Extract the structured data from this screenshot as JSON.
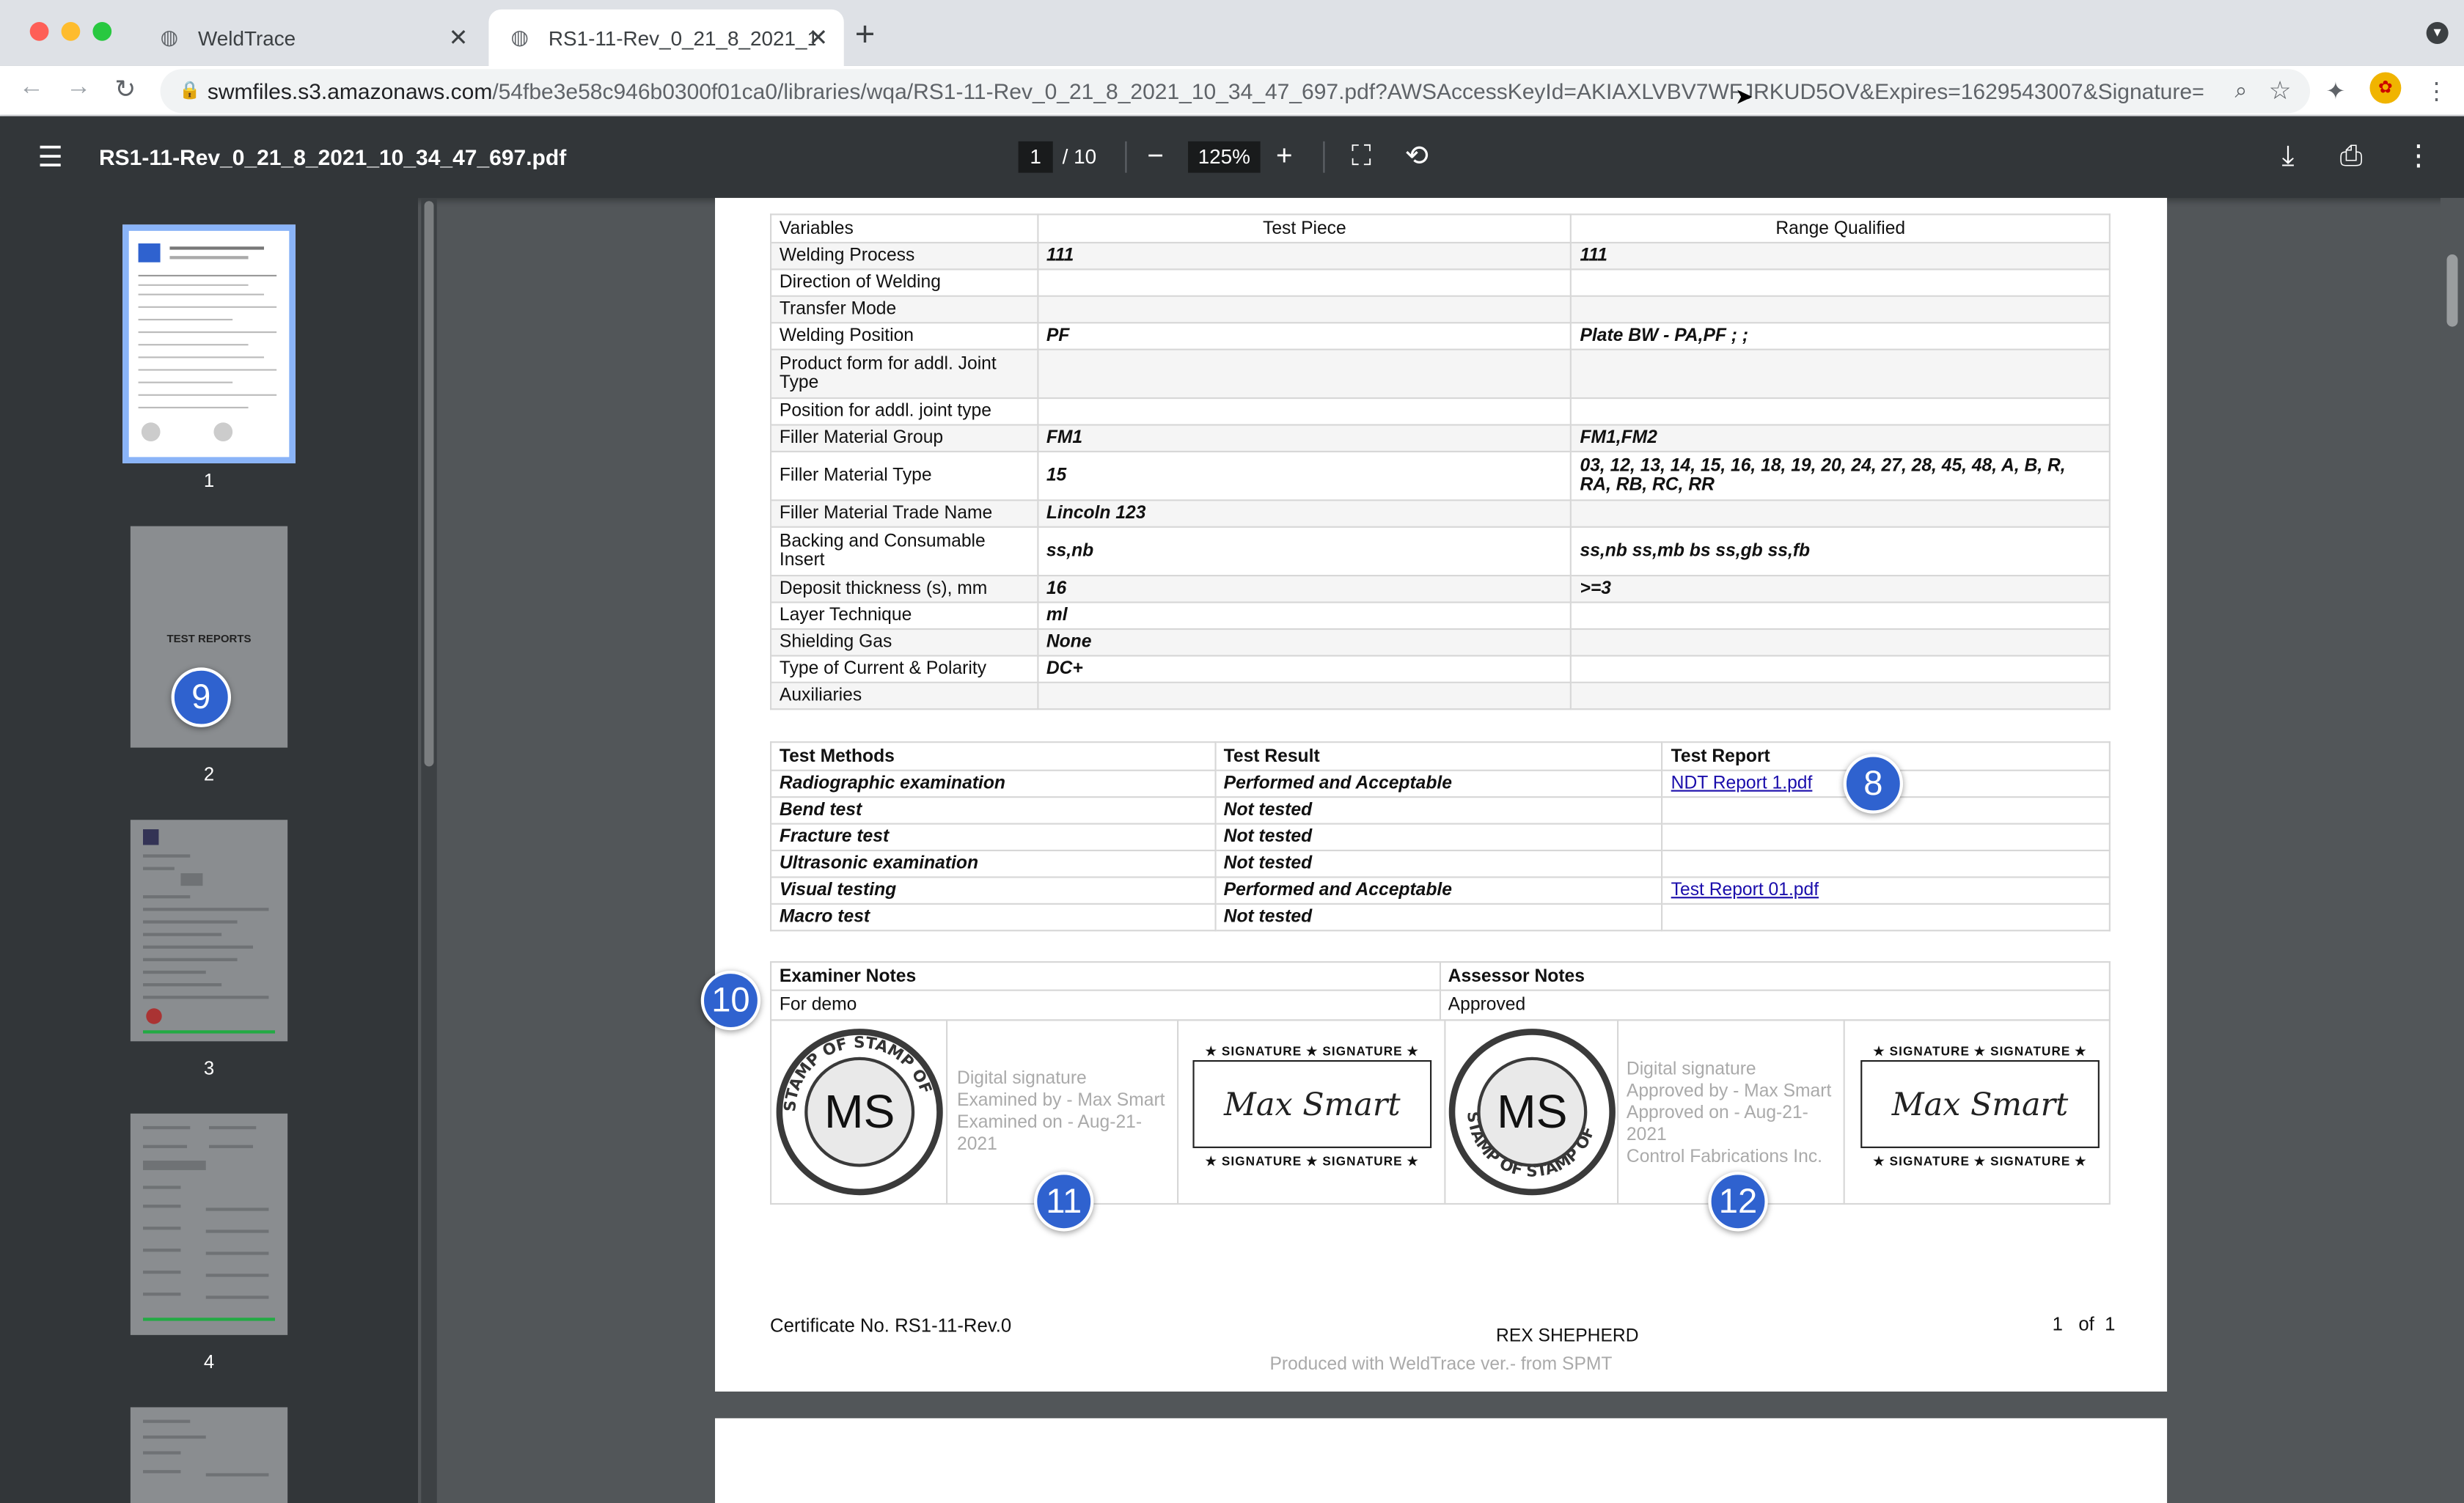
{
  "browser": {
    "tabs": [
      {
        "title": "WeldTrace"
      },
      {
        "title": "RS1-11-Rev_0_21_8_2021_10_"
      }
    ],
    "url_host": "swmfiles.s3.amazonaws.com",
    "url_path": "/54fbe3e58c946b0300f01ca0/libraries/wqa/RS1-11-Rev_0_21_8_2021_10_34_47_697.pdf?AWSAccessKeyId=AKIAXLVBV7WFJRKUD5OV&Expires=1629543007&Signature=q..."
  },
  "pdf": {
    "filename": "RS1-11-Rev_0_21_8_2021_10_34_47_697.pdf",
    "page_current": "1",
    "page_total": "/ 10",
    "zoom": "125%"
  },
  "thumbnails": [
    {
      "label": "1",
      "text": ""
    },
    {
      "label": "2",
      "text": "TEST REPORTS"
    },
    {
      "label": "3",
      "text": ""
    },
    {
      "label": "4",
      "text": ""
    }
  ],
  "variables_table": {
    "headers": [
      "Variables",
      "Test Piece",
      "Range Qualified"
    ],
    "rows": [
      [
        "Welding Process",
        "111",
        "111"
      ],
      [
        "Direction of Welding",
        "",
        ""
      ],
      [
        "Transfer Mode",
        "",
        ""
      ],
      [
        "Welding Position",
        "PF",
        "Plate BW - PA,PF ; ;"
      ],
      [
        "Product form for addl. Joint Type",
        "",
        ""
      ],
      [
        "Position for addl. joint type",
        "",
        ""
      ],
      [
        "Filler Material Group",
        "FM1",
        "FM1,FM2"
      ],
      [
        "Filler Material Type",
        "15",
        "03, 12, 13, 14, 15, 16, 18, 19, 20, 24, 27, 28, 45, 48, A, B, R, RA, RB, RC, RR"
      ],
      [
        "Filler Material Trade Name",
        "Lincoln 123",
        ""
      ],
      [
        "Backing and Consumable Insert",
        "ss,nb",
        "ss,nb ss,mb bs ss,gb ss,fb"
      ],
      [
        "Deposit thickness (s), mm",
        "16",
        ">=3"
      ],
      [
        "Layer Technique",
        "ml",
        ""
      ],
      [
        "Shielding Gas",
        "None",
        ""
      ],
      [
        "Type of Current & Polarity",
        "DC+",
        ""
      ],
      [
        "Auxiliaries",
        "",
        ""
      ]
    ]
  },
  "methods_table": {
    "headers": [
      "Test Methods",
      "Test Result",
      "Test Report"
    ],
    "rows": [
      [
        "Radiographic examination",
        "Performed and Acceptable",
        "NDT Report 1.pdf"
      ],
      [
        "Bend test",
        "Not tested",
        ""
      ],
      [
        "Fracture test",
        "Not tested",
        ""
      ],
      [
        "Ultrasonic examination",
        "Not tested",
        ""
      ],
      [
        "Visual testing",
        "Performed and Acceptable",
        "Test Report 01.pdf"
      ],
      [
        "Macro test",
        "Not tested",
        ""
      ]
    ]
  },
  "notes": {
    "examiner_header": "Examiner Notes",
    "assessor_header": "Assessor Notes",
    "examiner_text": "For demo",
    "assessor_text": "Approved"
  },
  "signatures": {
    "stamp_text": "MS",
    "stamp_ring": "STAMP OF STAMP OF",
    "sig_header": "★ SIGNATURE ★ SIGNATURE ★",
    "sig_name": "Max Smart",
    "examiner_lines": [
      "Digital signature",
      "Examined by - Max Smart",
      "Examined on - Aug-21-",
      "2021"
    ],
    "assessor_lines": [
      "Digital signature",
      "Approved by - Max Smart",
      "Approved on - Aug-21-",
      "2021",
      "Control Fabrications Inc."
    ]
  },
  "footer": {
    "certificate": "Certificate No. RS1-11-Rev.0",
    "name": "REX SHEPHERD",
    "produced": "Produced with WeldTrace ver.- from SPMT",
    "page": "1   of  1"
  },
  "badges": [
    "8",
    "9",
    "10",
    "11",
    "12"
  ],
  "colors": {
    "badge": "#2f62cf",
    "link": "#1a0dab",
    "pdf_toolbar": "#323639"
  }
}
